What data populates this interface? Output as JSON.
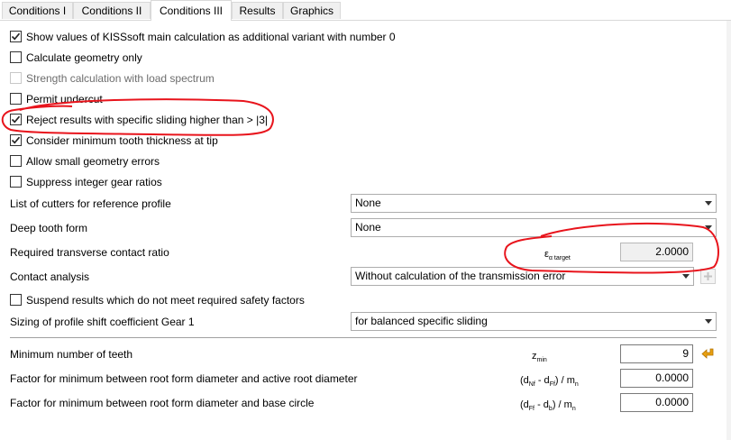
{
  "tabs": [
    {
      "label": "Conditions I",
      "active": false
    },
    {
      "label": "Conditions II",
      "active": false
    },
    {
      "label": "Conditions III",
      "active": true
    },
    {
      "label": "Results",
      "active": false
    },
    {
      "label": "Graphics",
      "active": false
    }
  ],
  "checkboxes": {
    "show_values": {
      "label": "Show values of KISSsoft main calculation as additional variant with number 0",
      "checked": true
    },
    "calc_geometry": {
      "label": "Calculate geometry only",
      "checked": false
    },
    "strength_spectrum": {
      "label": "Strength calculation with load spectrum",
      "checked": false,
      "disabled": true
    },
    "permit_undercut": {
      "label": "Permit undercut",
      "checked": false
    },
    "reject_sliding": {
      "label": "Reject results with specific sliding higher than > |3|",
      "checked": true
    },
    "min_tooth_thickness": {
      "label": "Consider minimum tooth thickness at tip",
      "checked": true
    },
    "small_geometry_errors": {
      "label": "Allow small geometry errors",
      "checked": false
    },
    "suppress_integer": {
      "label": "Suppress integer gear ratios",
      "checked": false
    },
    "suspend_results": {
      "label": "Suspend results which do not meet required safety factors",
      "checked": false
    }
  },
  "fields": {
    "cutters": {
      "label": "List of cutters for reference profile",
      "value": "None"
    },
    "deep_tooth": {
      "label": "Deep tooth form",
      "value": "None"
    },
    "contact_ratio": {
      "label": "Required transverse contact ratio",
      "symbol": "ε",
      "symbol_sub": "α target",
      "value": "2.0000"
    },
    "contact_analysis": {
      "label": "Contact analysis",
      "value": "Without calculation of the transmission error"
    },
    "sizing_shift": {
      "label": "Sizing of profile shift coefficient Gear 1",
      "value": "for balanced specific sliding"
    },
    "min_teeth": {
      "label": "Minimum number of teeth",
      "symbol": "z",
      "symbol_sub": "min",
      "value": "9"
    },
    "factor_active_root": {
      "label": "Factor for minimum between root form diameter and active root diameter",
      "symbol_a": "(d",
      "sub_a": "Nf",
      "symbol_b": " - d",
      "sub_b": "Ff",
      "symbol_c": ") / m",
      "sub_c": "n",
      "value": "0.0000"
    },
    "factor_base_circle": {
      "label": "Factor for minimum between root form diameter and base circle",
      "symbol_a": "(d",
      "sub_a": "Ff",
      "symbol_b": " - d",
      "sub_b": "b",
      "symbol_c": ") / m",
      "sub_c": "n",
      "value": "0.0000"
    }
  },
  "colors": {
    "annotation": "#e8141c",
    "accent_arrow": "#e8a010",
    "check": "#222222"
  },
  "icons": {
    "checkmark": "check-icon",
    "dropdown": "chevron-down-icon",
    "import": "arrow-left-icon",
    "plus": "plus-icon"
  }
}
